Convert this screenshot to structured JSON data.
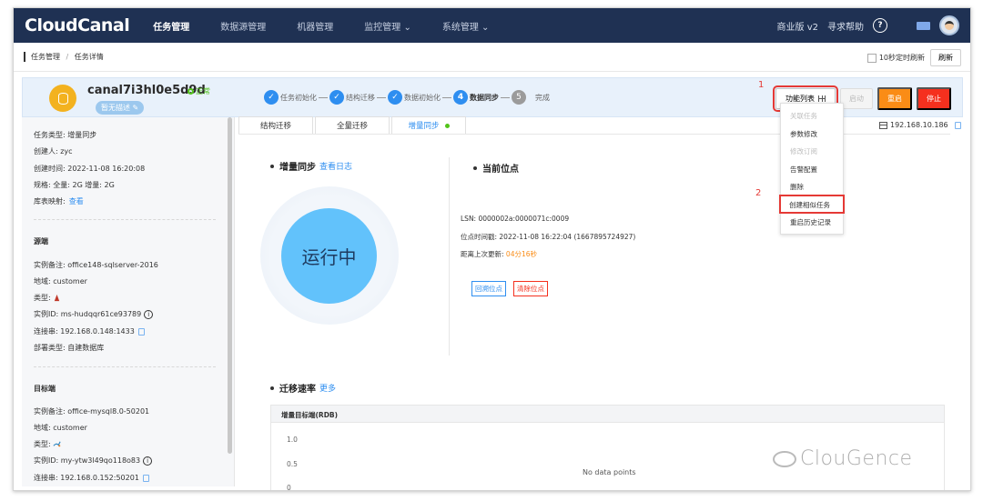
{
  "nav": {
    "logo": "CloudCanal",
    "items": [
      "任务管理",
      "数据源管理",
      "机器管理",
      "监控管理 ⌄",
      "系统管理 ⌄"
    ],
    "edition": "商业版 v2",
    "help": "寻求帮助",
    "help_glyph": "?"
  },
  "breadcrumb": {
    "root": "任务管理",
    "sep": "/",
    "current": "任务详情"
  },
  "toolbar": {
    "autorefresh_label": "10秒定时刷新",
    "refresh_label": "刷新"
  },
  "task": {
    "name": "canal7i3hl0e5d9d",
    "status": "正常",
    "desc": "暂无描述 ✎",
    "steps": [
      {
        "num": "✓",
        "label": "任务初始化"
      },
      {
        "num": "✓",
        "label": "结构迁移"
      },
      {
        "num": "✓",
        "label": "数据初始化"
      },
      {
        "num": "4",
        "label": "数据同步"
      },
      {
        "num": "5",
        "label": "完成"
      }
    ],
    "buttons": {
      "func_list": "功能列表",
      "start": "启动",
      "restart": "重启",
      "stop": "停止"
    },
    "annotation_1": "1",
    "annotation_2": "2"
  },
  "dropdown": [
    {
      "label": "关联任务",
      "disabled": true
    },
    {
      "label": "参数修改",
      "disabled": false
    },
    {
      "label": "修改订阅",
      "disabled": true
    },
    {
      "label": "告警配置",
      "disabled": false
    },
    {
      "label": "删除",
      "disabled": false
    },
    {
      "label": "创建相似任务",
      "disabled": false,
      "highlight": true
    },
    {
      "label": "重启历史记录",
      "disabled": false
    }
  ],
  "sidebar": {
    "task_type": "任务类型: 增量同步",
    "creator": "创建人: zyc",
    "created": "创建时间: 2022-11-08 16:20:08",
    "spec": "规格: 全量: 2G 增量: 2G",
    "mapping_label": "库表映射:",
    "mapping_link": "查看",
    "source_title": "源端",
    "src_note": "实例备注: office148-sqlserver-2016",
    "src_region": "地域: customer",
    "src_type": "类型:",
    "src_id": "实例ID: ms-hudqqr61ce93789",
    "src_conn": "连接串: 192.168.0.148:1433",
    "src_deploy": "部署类型: 自建数据库",
    "target_title": "目标端",
    "dst_note": "实例备注: office-mysql8.0-50201",
    "dst_region": "地域: customer",
    "dst_type": "类型:",
    "dst_id": "实例ID: my-ytw3l49qo118o83",
    "dst_conn": "连接串: 192.168.0.152:50201"
  },
  "tabs": [
    "结构迁移",
    "全量迁移",
    "增量同步"
  ],
  "ip": "192.168.10.186",
  "sync": {
    "title": "增量同步",
    "log_link": "查看日志",
    "running": "运行中",
    "pos_title": "当前位点",
    "lsn": "LSN: 0000002a:0000071c:0009",
    "pos_time": "位点时间戳: 2022-11-08 16:22:04 (1667895724927)",
    "last_update_label": "距离上次更新:",
    "last_update_value": "04分16秒",
    "btn_rollback": "回溯位点",
    "btn_clear": "清除位点"
  },
  "rate": {
    "title": "迁移速率",
    "more": "更多",
    "chart_title": "增量目标端(RDB)",
    "y_ticks": [
      "1.0",
      "0.5",
      "0"
    ],
    "nodata": "No data points"
  },
  "watermark": "ClouGence",
  "colors": {
    "nav_bg": "#1f3153",
    "accent": "#2e8ef0",
    "ok": "#52c41a",
    "warn": "#fa8c16",
    "danger": "#f5301e"
  }
}
